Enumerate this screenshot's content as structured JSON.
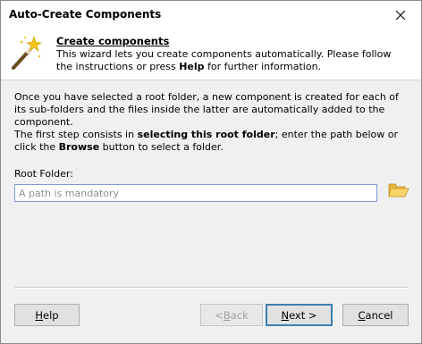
{
  "window": {
    "title": "Auto-Create Components"
  },
  "header": {
    "title": "Create components",
    "desc_part1": "This wizard lets you create components automatically. Please follow the instructions or press ",
    "desc_bold": "Help",
    "desc_part2": " for further information."
  },
  "body": {
    "para1": "Once you have selected a root folder, a new component is created for each of its sub-folders and the files inside the latter are automatically added to the component.",
    "para2_part1": "The first step consists in ",
    "para2_bold1": "selecting this root folder",
    "para2_part2": "; enter the path below or click the ",
    "para2_bold2": "Browse",
    "para2_part3": " button to select a folder."
  },
  "root_folder": {
    "label": "Root Folder:",
    "value": "",
    "placeholder": "A path is mandatory"
  },
  "buttons": {
    "help_mnemonic": "H",
    "help_rest": "elp",
    "back_prefix": "< ",
    "back_mnemonic": "B",
    "back_rest": "ack",
    "next_mnemonic": "N",
    "next_rest": "ext >",
    "cancel_mnemonic": "C",
    "cancel_rest": "ancel",
    "next_state": "default",
    "back_state": "disabled"
  },
  "icons": {
    "close": "close-icon",
    "wizard": "magic-wand-icon",
    "browse": "folder-open-icon"
  },
  "colors": {
    "accent": "#3c7fb1",
    "input_border": "#7a9cd3",
    "folder": "#f0c050"
  }
}
